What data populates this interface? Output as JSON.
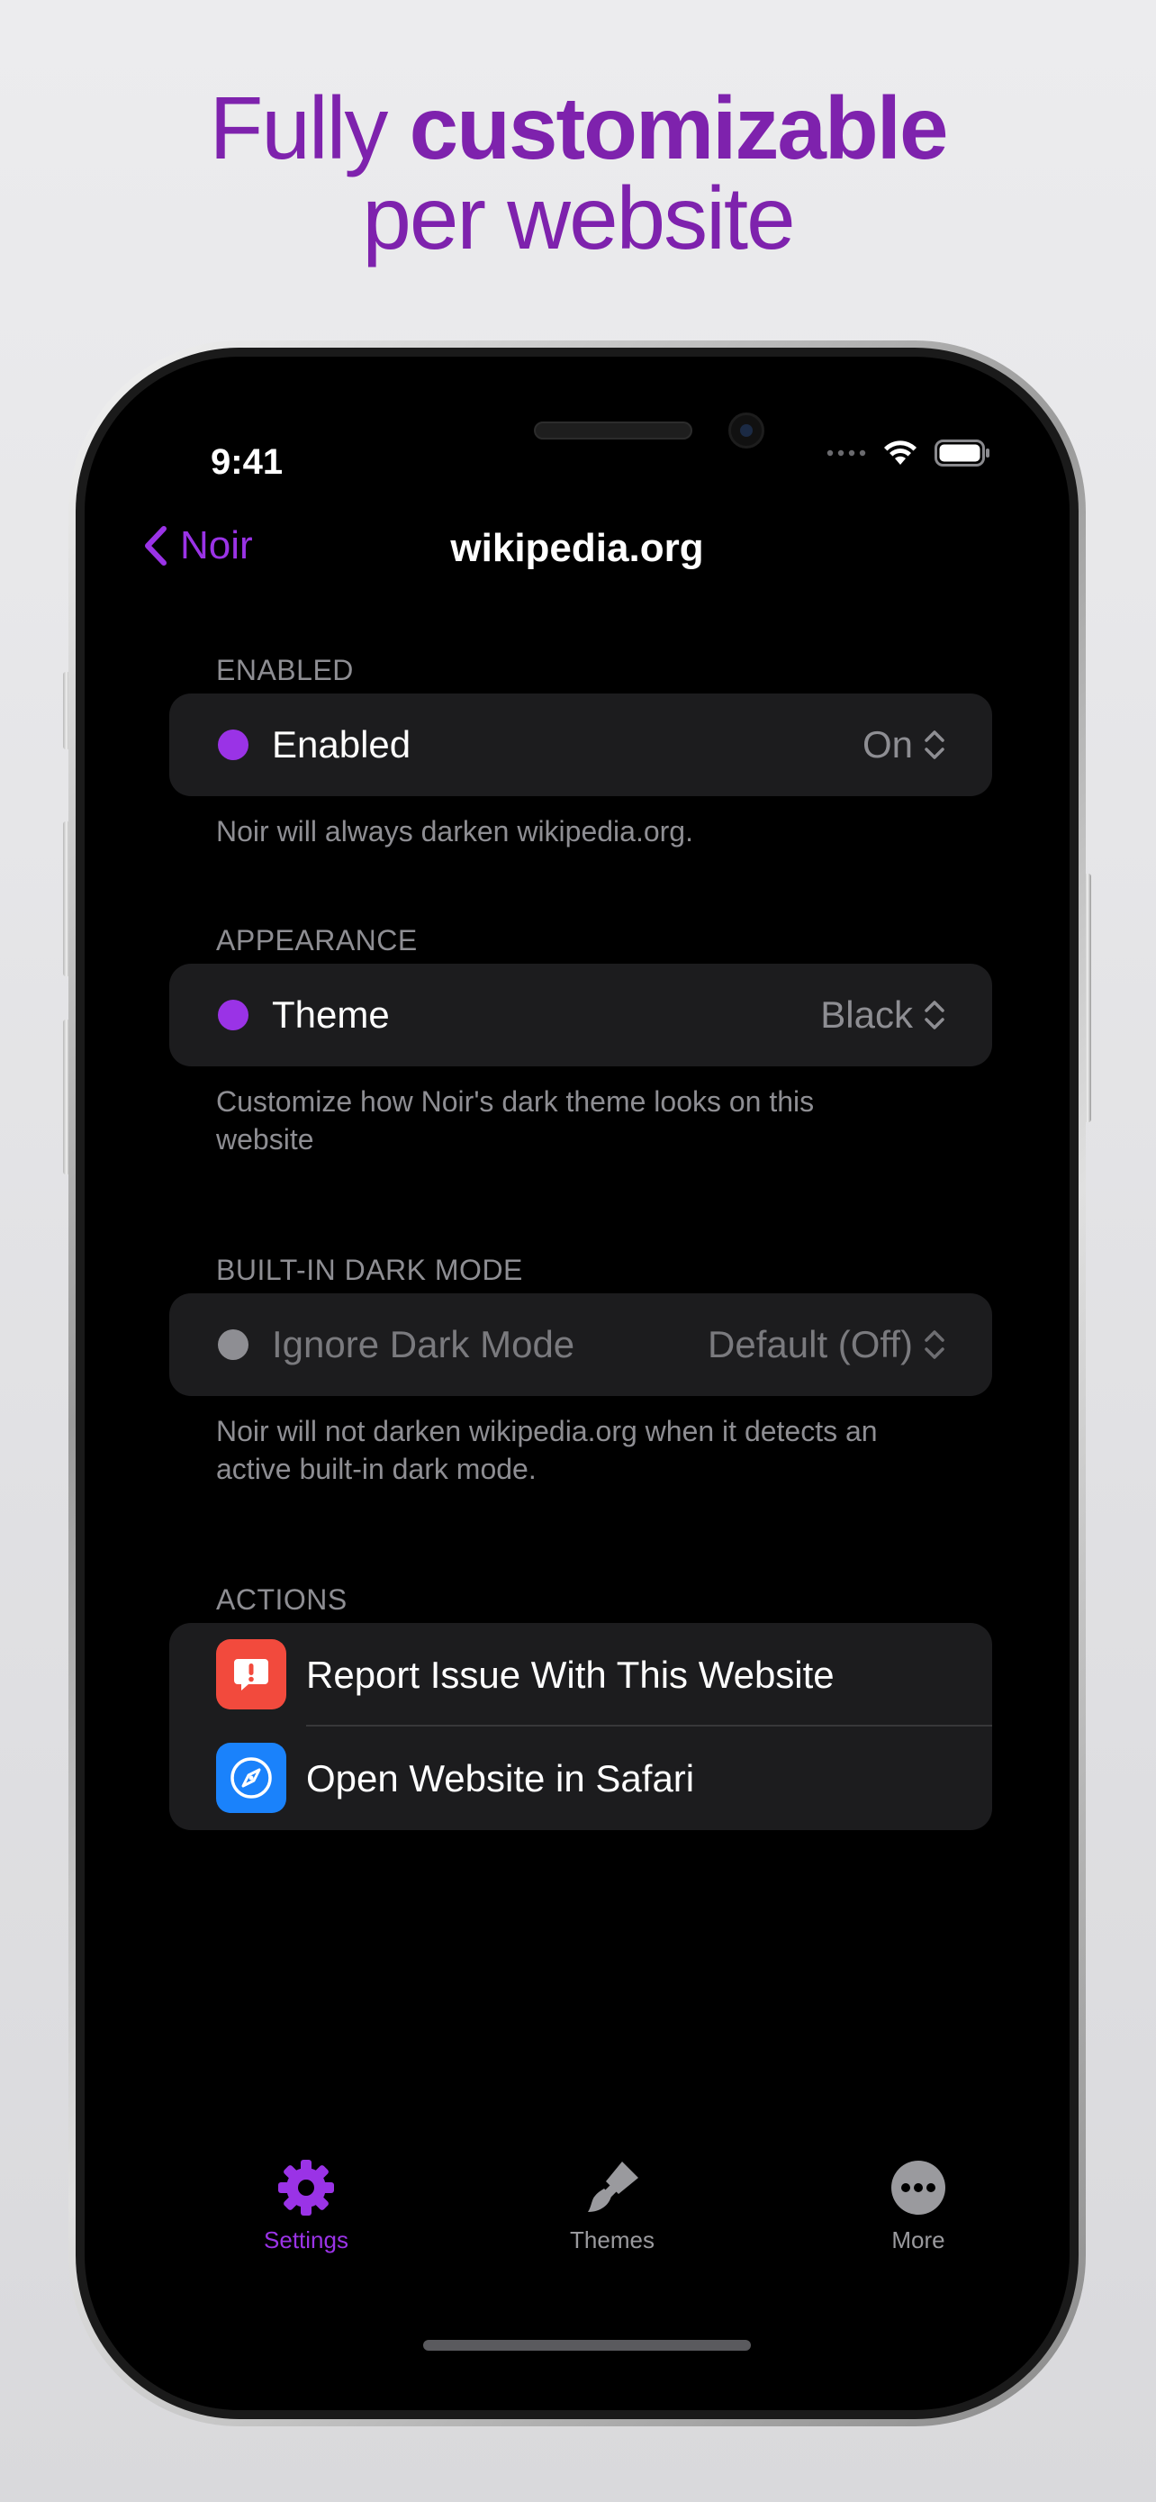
{
  "promo": {
    "headline_regular": "Fully ",
    "headline_bold": "customizable",
    "headline_line2": "per website"
  },
  "status_bar": {
    "time": "9:41"
  },
  "nav": {
    "back_label": "Noir",
    "title": "wikipedia.org"
  },
  "sections": {
    "enabled": {
      "header": "ENABLED",
      "row_label": "Enabled",
      "row_value": "On",
      "footer": "Noir will always darken wikipedia.org."
    },
    "appearance": {
      "header": "APPEARANCE",
      "row_label": "Theme",
      "row_value": "Black",
      "footer": "Customize how Noir's dark theme looks on this website"
    },
    "dark_mode": {
      "header": "BUILT-IN DARK MODE",
      "row_label": "Ignore Dark Mode",
      "row_value": "Default (Off)",
      "footer": "Noir will not darken wikipedia.org when it detects an active built-in dark mode."
    },
    "actions": {
      "header": "ACTIONS",
      "items": [
        {
          "label": "Report Issue With This Website",
          "icon": "report-issue-icon",
          "color": "#f24a3d"
        },
        {
          "label": "Open Website in Safari",
          "icon": "safari-compass-icon",
          "color": "#1a82fb"
        }
      ]
    }
  },
  "tabs": [
    {
      "label": "Settings",
      "icon": "gear-icon",
      "active": true
    },
    {
      "label": "Themes",
      "icon": "paintbrush-icon",
      "active": false
    },
    {
      "label": "More",
      "icon": "ellipsis-circle-icon",
      "active": false
    }
  ],
  "colors": {
    "accent": "#9a33e6",
    "headline": "#7e22ad",
    "inactive_dot": "#8e8e93",
    "tab_inactive": "#9a9a9e",
    "card": "#1c1c1e"
  }
}
